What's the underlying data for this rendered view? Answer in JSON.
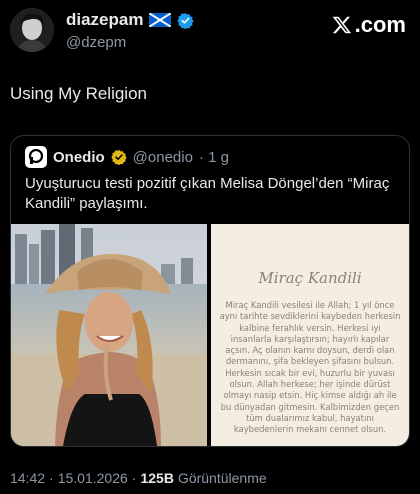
{
  "author": {
    "display_name": "diazepam",
    "handle": "@dzepm",
    "flag": "scotland-flag-icon",
    "verified_color": "#1d9bf0"
  },
  "brand": {
    "label": ".com",
    "icon": "x-logo-icon"
  },
  "tweet": {
    "text": "Using My Religion"
  },
  "quote": {
    "name": "Onedio",
    "handle": "@onedio",
    "time": "· 1 g",
    "verified_color": "#e2b719",
    "text": "Uyuşturucu testi pozitif çıkan Melisa Döngel’den “Miraç Kandili” paylaşımı.",
    "card": {
      "title": "Miraç Kandili",
      "body": "Miraç Kandili vesilesi ile Allah; 1 yıl önce aynı tarihte sevdiklerini kaybeden herkesin kalbine ferahlık versin. Herkesi iyi insanlarla karşılaştırsın; hayırlı kapılar açsın. Aç olanın karnı doysun, derdi olan dermanını, şifa bekleyen şifasını bulsun. Herkesin sıcak bir evi, huzurlu bir yuvası olsun. Allah herkese; her işinde dürüst olmayı nasip etsin. Hiç kimse aldığı ah ile bu dünyadan gitmesin. Kalbimizden geçen tüm dualarımız kabul, hayatını kaybedenlerin mekanı cennet olsun."
    }
  },
  "meta": {
    "time": "14:42",
    "sep": "·",
    "date": "15.01.2026",
    "views_count": "125B",
    "views_label": "Görüntülenme"
  }
}
